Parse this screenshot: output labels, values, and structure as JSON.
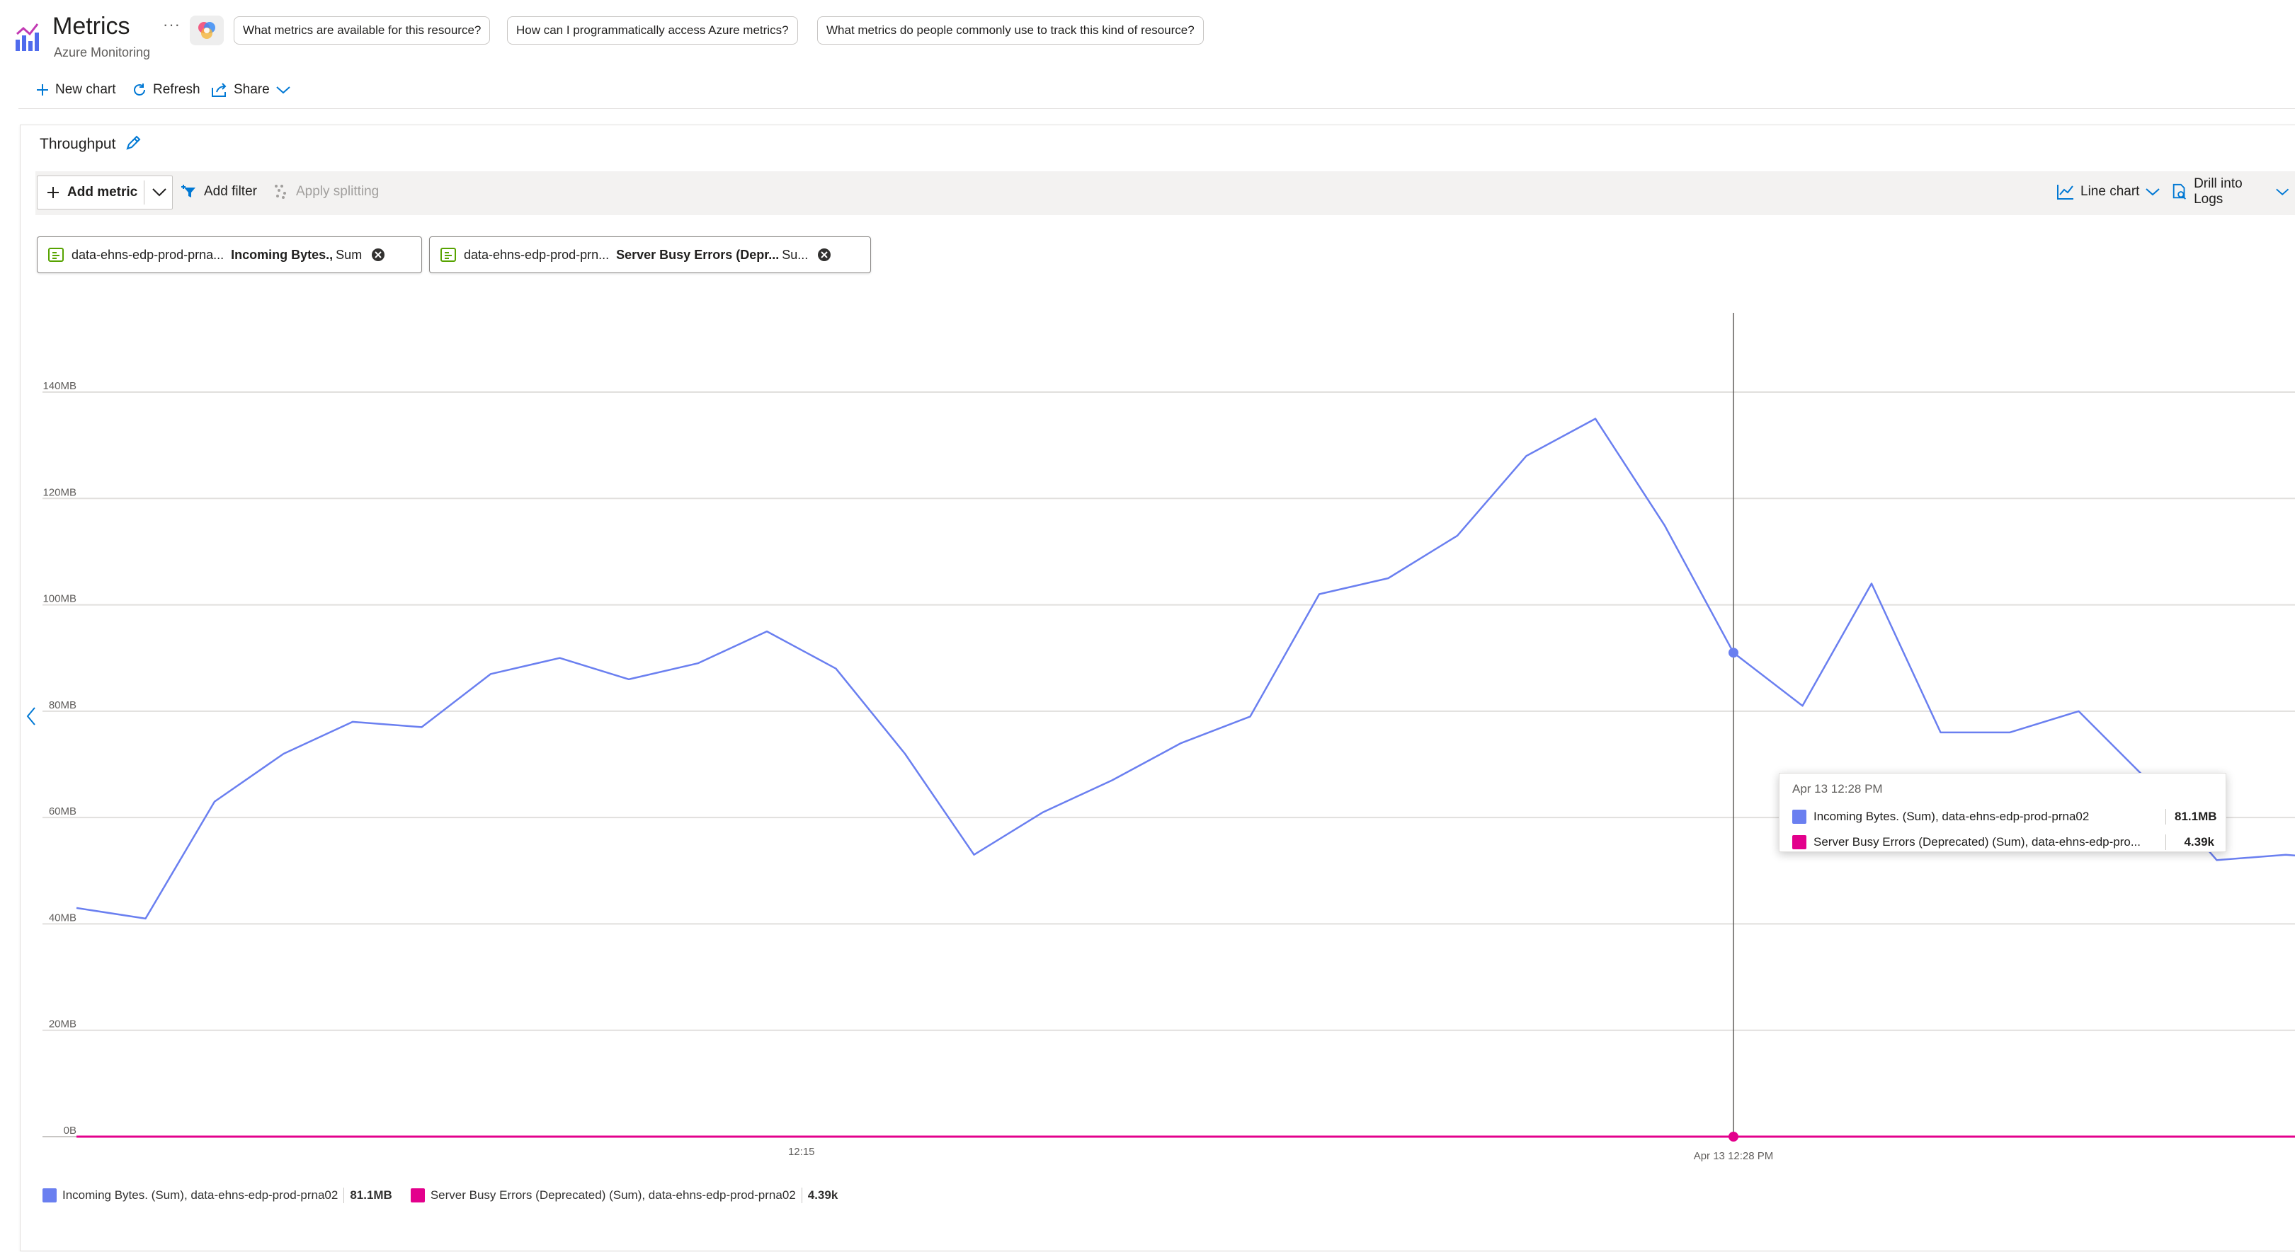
{
  "header": {
    "title": "Metrics",
    "subtitle": "Azure Monitoring",
    "more_label": "···",
    "suggestions": [
      "What metrics are available for this resource?",
      "How can I programmatically access Azure metrics?",
      "What metrics do people commonly use to track this kind of resource?"
    ]
  },
  "command_bar": {
    "new_chart": "New chart",
    "refresh": "Refresh",
    "share": "Share"
  },
  "chart_panel": {
    "title": "Throughput",
    "toolbar": {
      "add_metric": "Add metric",
      "add_filter": "Add filter",
      "apply_splitting": "Apply splitting",
      "line_chart": "Line chart",
      "drill_into_logs": "Drill into Logs"
    },
    "metric_chips": [
      {
        "resource": "data-ehns-edp-prod-prna...",
        "metric": "Incoming Bytes.,",
        "aggregation": "Sum"
      },
      {
        "resource": "data-ehns-edp-prod-prn...",
        "metric": "Server Busy Errors (Depr...",
        "aggregation": "Su..."
      }
    ],
    "tooltip": {
      "time": "Apr 13 12:28 PM",
      "rows": [
        {
          "name": "Incoming Bytes. (Sum), data-ehns-edp-prod-prna02",
          "value": "81.1MB"
        },
        {
          "name": "Server Busy Errors (Deprecated) (Sum), data-ehns-edp-pro...",
          "value": "4.39k"
        }
      ]
    },
    "legend": [
      {
        "name": "Incoming Bytes. (Sum), data-ehns-edp-prod-prna02",
        "value": "81.1MB"
      },
      {
        "name": "Server Busy Errors (Deprecated) (Sum), data-ehns-edp-prod-prna02",
        "value": "4.39k"
      }
    ]
  },
  "colors": {
    "incoming_bytes": "#6a7ff0",
    "server_busy_errors": "#e3008c",
    "accent": "#0078d4"
  },
  "chart_data": {
    "type": "line",
    "ylim": [
      0,
      150
    ],
    "yunit": "MB",
    "yticks": [
      "0B",
      "20MB",
      "40MB",
      "60MB",
      "80MB",
      "100MB",
      "120MB",
      "140MB"
    ],
    "xtick_labels": [
      "12:15",
      "Apr 13 12:28 PM"
    ],
    "xtick_index": [
      10.5,
      24
    ],
    "cursor_index": 24,
    "series": [
      {
        "name": "Incoming Bytes. (Sum), data-ehns-edp-prod-prna02",
        "values": [
          43,
          41,
          63,
          72,
          78,
          77,
          87,
          90,
          86,
          89,
          95,
          88,
          72,
          53,
          61,
          67,
          74,
          79,
          102,
          105,
          113,
          128,
          135,
          115,
          91,
          81,
          104,
          76,
          76,
          80,
          67,
          52,
          53,
          52
        ]
      },
      {
        "name": "Server Busy Errors (Deprecated) (Sum), data-ehns-edp-prod-prna02",
        "values": [
          0,
          0,
          0,
          0,
          0,
          0,
          0,
          0,
          0,
          0,
          0,
          0,
          0,
          0,
          0,
          0,
          0,
          0,
          0,
          0,
          0,
          0,
          0,
          0,
          0,
          0,
          0,
          0,
          0,
          0,
          0,
          0,
          0,
          0
        ]
      }
    ]
  }
}
